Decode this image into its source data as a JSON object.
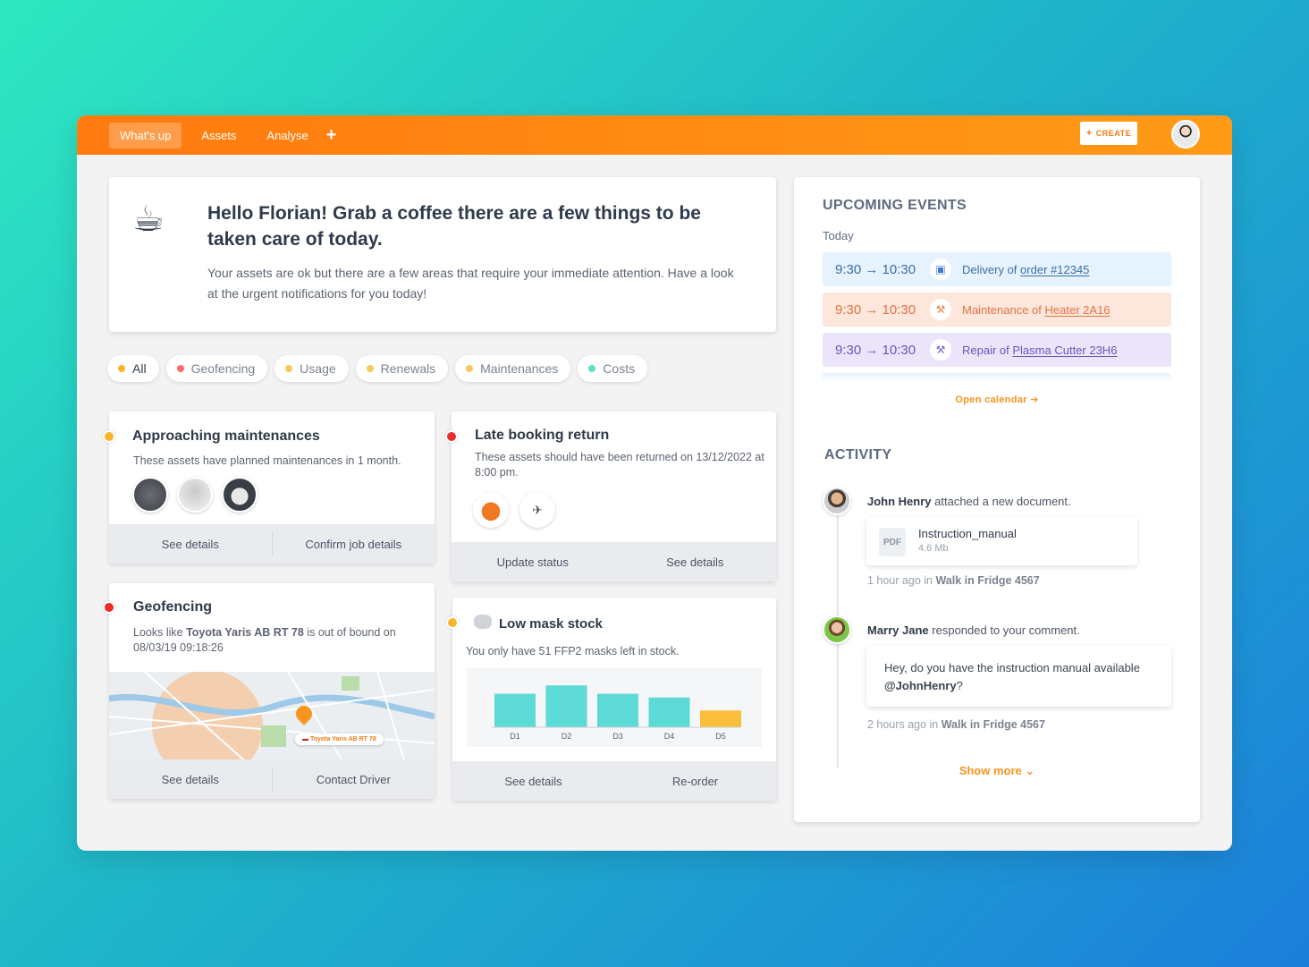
{
  "nav": {
    "items": [
      "What's up",
      "Assets",
      "Analyse"
    ],
    "plus": "+",
    "create": "CREATE",
    "create_icon": "+"
  },
  "hello": {
    "title": "Hello Florian! Grab a coffee there are a few things to be taken care of today.",
    "text": "Your assets are ok but there are a few areas that require your immediate attention. Have a look at the urgent notifications for you today!",
    "icon": "coffee-icon"
  },
  "filters": [
    {
      "label": "All",
      "color": "#f7b52c"
    },
    {
      "label": "Geofencing",
      "color": "#ff6b6b"
    },
    {
      "label": "Usage",
      "color": "#f7c95a"
    },
    {
      "label": "Renewals",
      "color": "#f7c95a"
    },
    {
      "label": "Maintenances",
      "color": "#f7c95a"
    },
    {
      "label": "Costs",
      "color": "#5ee0c8"
    }
  ],
  "approaching": {
    "title": "Approaching maintenances",
    "desc": "These assets have planned maintenances in 1 month.",
    "btn1": "See details",
    "btn2": "Confirm job details"
  },
  "late": {
    "title": "Late booking return",
    "desc": "These assets should have been returned on 13/12/2022 at 8:00 pm.",
    "btn1": "Update status",
    "btn2": "See details"
  },
  "geo": {
    "title": "Geofencing",
    "desc_pre": "Looks like",
    "car": "Toyota Yaris AB RT 78",
    "desc_post": "is out of bound on 08/03/19 09:18:26",
    "map_label": "Toyota Yaris AB RT 78",
    "btn1": "See details",
    "btn2": "Contact Driver"
  },
  "mask": {
    "title": "Low mask stock",
    "desc": "You only have 51 FFP2 masks left in stock.",
    "btn1": "See details",
    "btn2": "Re-order"
  },
  "chart_data": {
    "type": "bar",
    "categories": [
      "D1",
      "D2",
      "D3",
      "D4",
      "D5"
    ],
    "values": [
      36,
      45,
      36,
      32,
      18
    ],
    "colors": [
      "#5dd9d6",
      "#5dd9d6",
      "#5dd9d6",
      "#5dd9d6",
      "#fbbd3c"
    ],
    "ylim": [
      0,
      50
    ]
  },
  "events": {
    "title": "UPCOMING EVENTS",
    "today": "Today",
    "items": [
      {
        "time": "9:30 → 10:30",
        "pre": "Delivery of",
        "link": "order #12345",
        "icon": "box-icon"
      },
      {
        "time": "9:30 → 10:30",
        "pre": "Maintenance of",
        "link": "Heater 2A16",
        "icon": "wrench-icon"
      },
      {
        "time": "9:30 → 10:30",
        "pre": "Repair of",
        "link": "Plasma Cutter 23H6",
        "icon": "wrench-icon"
      }
    ],
    "open_calendar": "Open calendar ➔"
  },
  "activity": {
    "title": "ACTIVITY",
    "a1": {
      "name": "John Henry",
      "action": "attached a new document.",
      "file": "Instruction_manual",
      "size": "4.6 Mb",
      "badge": "PDF",
      "time": "1 hour ago in",
      "place": "Walk in Fridge 4567"
    },
    "a2": {
      "name": "Marry Jane",
      "action": "responded to your comment.",
      "comment": "Hey, do you have the instruction manual available",
      "mention": "@JohnHenry",
      "qmark": "?",
      "time": "2 hours ago in",
      "place": "Walk in Fridge 4567"
    },
    "show_more": "Show more"
  }
}
